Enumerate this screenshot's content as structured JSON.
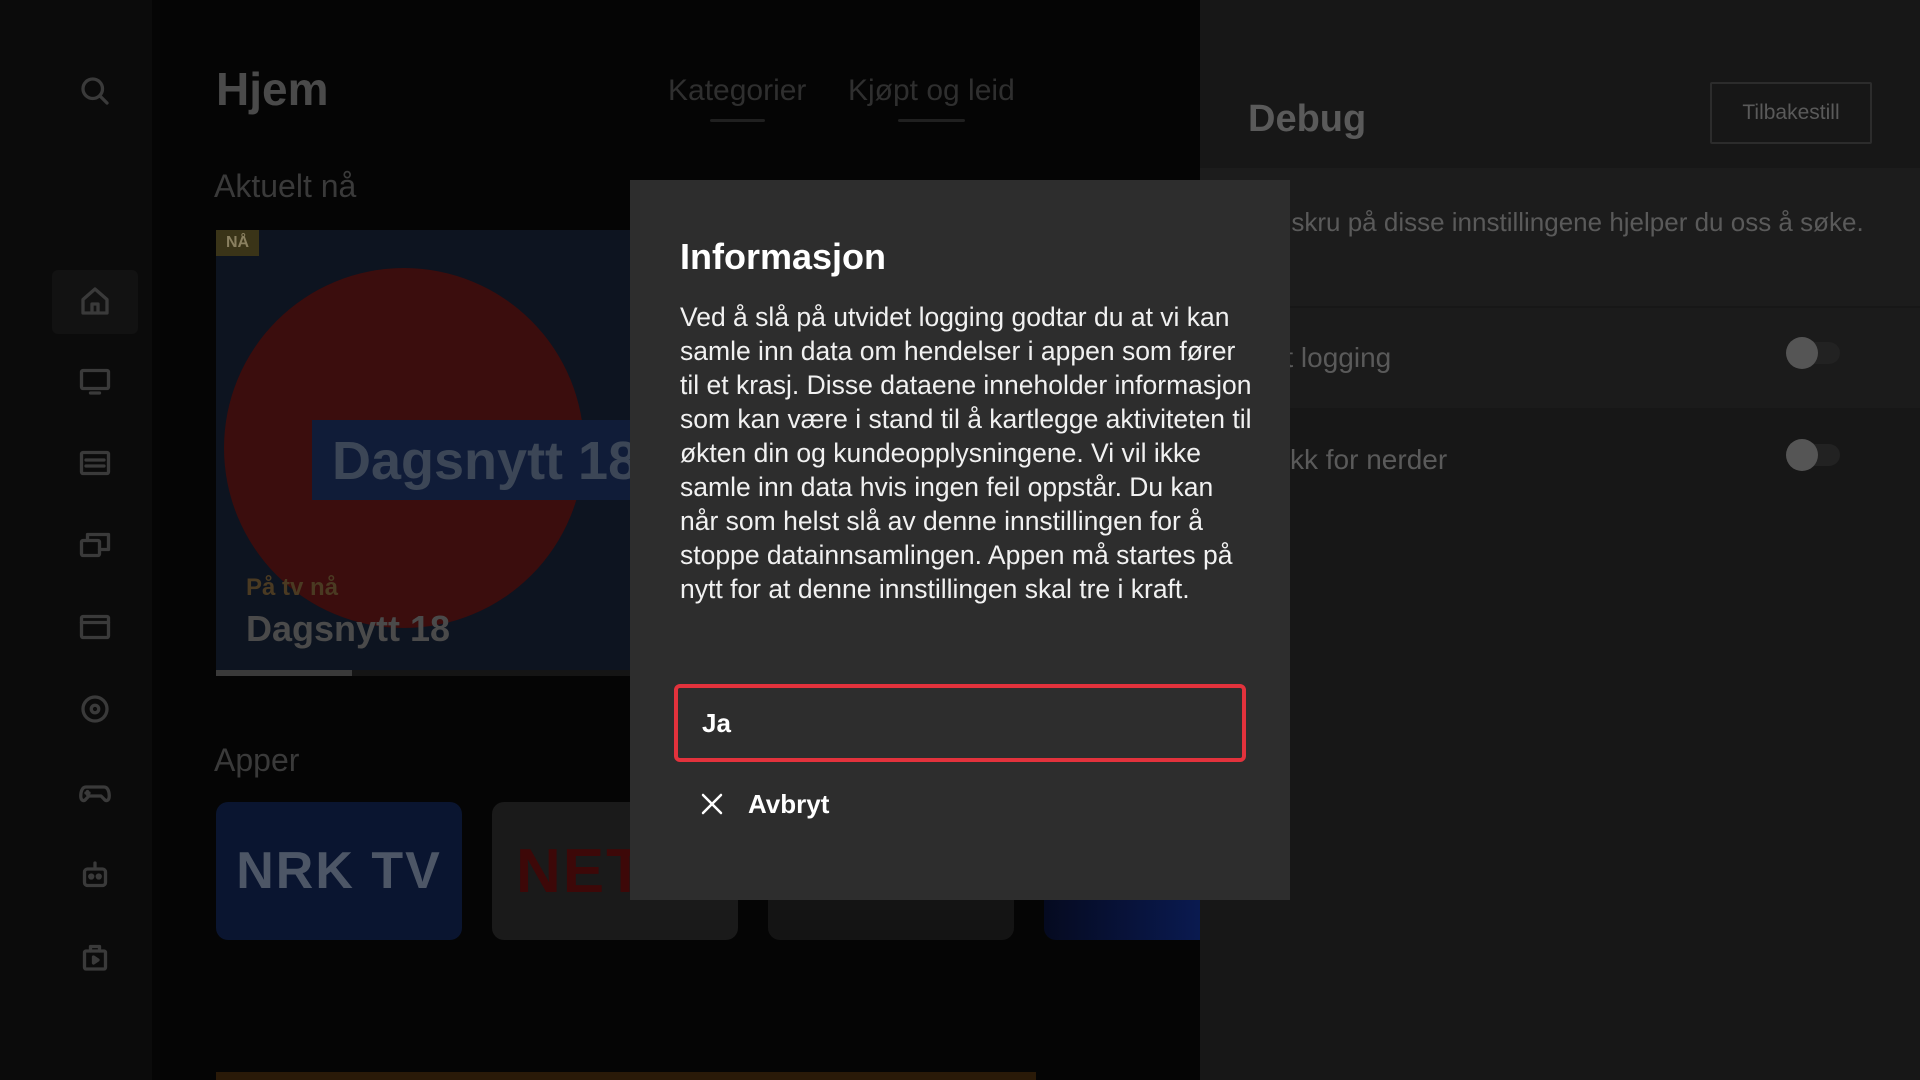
{
  "sidebar": {
    "icons": [
      "search-icon",
      "home-icon",
      "tv-icon",
      "guide-icon",
      "library-icon",
      "movies-icon",
      "record-icon",
      "gamepad-icon",
      "robot-icon",
      "store-icon"
    ]
  },
  "main": {
    "page_title": "Hjem",
    "tabs": [
      {
        "label": "Kategorier"
      },
      {
        "label": "Kjøpt og leid"
      }
    ],
    "now_section": "Aktuelt nå",
    "hero": {
      "badge": "NÅ",
      "program_logo_text": "Dagsnytt 18",
      "subtitle": "På tv nå",
      "title": "Dagsnytt 18",
      "progress_fraction": 0.31
    },
    "apps_section": "Apper",
    "apps": [
      {
        "name": "NRK TV"
      },
      {
        "name": "NETF"
      }
    ]
  },
  "debug": {
    "title": "Debug",
    "reset_label": "Tilbakestill",
    "description": "d å skru på disse innstillingene hjelper du oss å søke.",
    "settings": [
      {
        "label": "idet logging",
        "enabled": false
      },
      {
        "label": "tistikk for nerder",
        "enabled": false
      }
    ]
  },
  "modal": {
    "title": "Informasjon",
    "body": "Ved å slå på utvidet logging godtar du at vi kan samle inn data om hendelser i appen som fører til et krasj. Disse dataene inneholder informasjon som kan være i stand til å kartlegge aktiviteten til økten din og kundeopplysningene. Vi vil ikke samle inn data hvis ingen feil oppstår. Du kan når som helst slå av denne innstillingen for å stoppe datainnsamlingen. Appen må startes på nytt for at denne innstillingen skal tre i kraft.",
    "confirm_label": "Ja",
    "cancel_label": "Avbryt"
  },
  "colors": {
    "focus_border": "#e2323c",
    "modal_bg": "#2d2d2d",
    "panel_bg": "#171717"
  }
}
